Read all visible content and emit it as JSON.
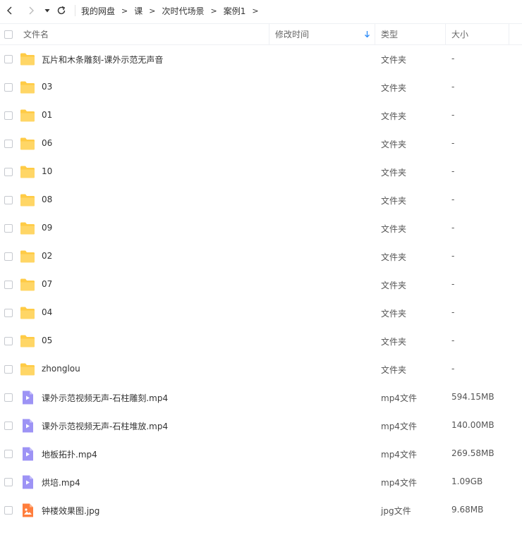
{
  "toolbar": {
    "back_icon": "chevron-left-icon",
    "forward_icon": "chevron-right-icon",
    "history_icon": "caret-down-icon",
    "refresh_icon": "refresh-icon"
  },
  "breadcrumb": [
    {
      "label": "我的网盘"
    },
    {
      "label": "课"
    },
    {
      "label": "次时代场景"
    },
    {
      "label": "案例1"
    }
  ],
  "breadcrumb_separator": ">",
  "table": {
    "headers": {
      "name": "文件名",
      "mtime": "修改时间",
      "type": "类型",
      "size": "大小"
    },
    "sort_icon": "arrow-down-icon",
    "rows": [
      {
        "name": "瓦片和木条雕刻-课外示范无声音",
        "type": "文件夹",
        "size": "-",
        "icon": "folder-icon"
      },
      {
        "name": "03",
        "type": "文件夹",
        "size": "-",
        "icon": "folder-icon"
      },
      {
        "name": "01",
        "type": "文件夹",
        "size": "-",
        "icon": "folder-icon"
      },
      {
        "name": "06",
        "type": "文件夹",
        "size": "-",
        "icon": "folder-icon"
      },
      {
        "name": "10",
        "type": "文件夹",
        "size": "-",
        "icon": "folder-icon"
      },
      {
        "name": "08",
        "type": "文件夹",
        "size": "-",
        "icon": "folder-icon"
      },
      {
        "name": "09",
        "type": "文件夹",
        "size": "-",
        "icon": "folder-icon"
      },
      {
        "name": "02",
        "type": "文件夹",
        "size": "-",
        "icon": "folder-icon"
      },
      {
        "name": "07",
        "type": "文件夹",
        "size": "-",
        "icon": "folder-icon"
      },
      {
        "name": "04",
        "type": "文件夹",
        "size": "-",
        "icon": "folder-icon"
      },
      {
        "name": "05",
        "type": "文件夹",
        "size": "-",
        "icon": "folder-icon"
      },
      {
        "name": "zhonglou",
        "type": "文件夹",
        "size": "-",
        "icon": "folder-icon"
      },
      {
        "name": "课外示范视频无声-石柱雕刻.mp4",
        "type": "mp4文件",
        "size": "594.15MB",
        "icon": "video-file-icon"
      },
      {
        "name": "课外示范视频无声-石柱堆放.mp4",
        "type": "mp4文件",
        "size": "140.00MB",
        "icon": "video-file-icon"
      },
      {
        "name": "地板拓扑.mp4",
        "type": "mp4文件",
        "size": "269.58MB",
        "icon": "video-file-icon"
      },
      {
        "name": "烘培.mp4",
        "type": "mp4文件",
        "size": "1.09GB",
        "icon": "video-file-icon"
      },
      {
        "name": "钟楼效果图.jpg",
        "type": "jpg文件",
        "size": "9.68MB",
        "icon": "image-file-icon"
      }
    ]
  },
  "colors": {
    "folder": "#FFCB45",
    "video": "#9D93F5",
    "image": "#FF7E3D",
    "sort_arrow": "#2B8AF7"
  }
}
